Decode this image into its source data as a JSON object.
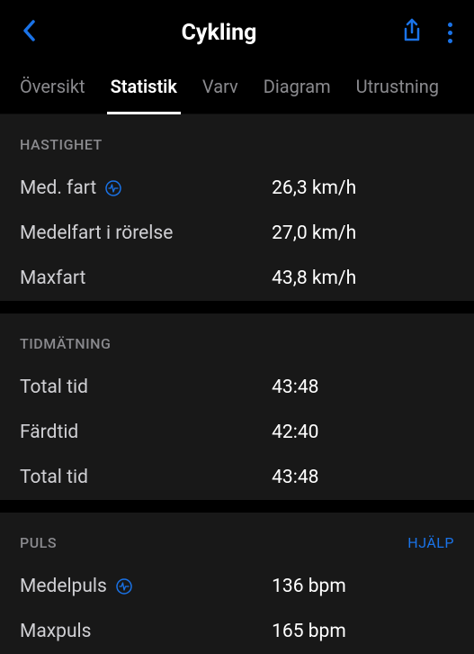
{
  "header": {
    "title": "Cykling"
  },
  "tabs": {
    "items": [
      {
        "label": "Översikt"
      },
      {
        "label": "Statistik"
      },
      {
        "label": "Varv"
      },
      {
        "label": "Diagram"
      },
      {
        "label": "Utrustning"
      }
    ]
  },
  "sections": {
    "speed": {
      "title": "HASTIGHET",
      "rows": {
        "avg": {
          "label": "Med. fart",
          "value": "26,3 km/h"
        },
        "moving": {
          "label": "Medelfart i rörelse",
          "value": "27,0 km/h"
        },
        "max": {
          "label": "Maxfart",
          "value": "43,8 km/h"
        }
      }
    },
    "timing": {
      "title": "TIDMÄTNING",
      "rows": {
        "total1": {
          "label": "Total tid",
          "value": "43:48"
        },
        "moving": {
          "label": "Färdtid",
          "value": "42:40"
        },
        "total2": {
          "label": "Total tid",
          "value": "43:48"
        }
      }
    },
    "pulse": {
      "title": "PULS",
      "help": "HJÄLP",
      "rows": {
        "avg": {
          "label": "Medelpuls",
          "value": "136 bpm"
        },
        "max": {
          "label": "Maxpuls",
          "value": "165 bpm"
        }
      }
    }
  }
}
